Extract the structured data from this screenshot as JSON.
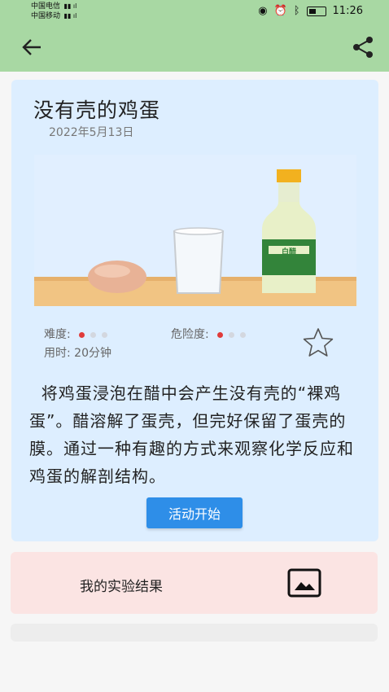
{
  "status_bar": {
    "carrier1": "中国电信",
    "carrier2": "中国移动",
    "time": "11:26"
  },
  "colors": {
    "appbar": "#a8d8a3",
    "card_bg": "#ddeeff",
    "result_bg": "#fbe4e3",
    "accent_button": "#2e8ee8",
    "level_dot": "#e03b3b"
  },
  "icons": {
    "back": "arrow-left",
    "share": "share",
    "favorite": "star-outline",
    "image": "image-frame"
  },
  "article": {
    "title": "没有壳的鸡蛋",
    "date": "2022年5月13日",
    "bottle_label": "白醋",
    "difficulty_label": "难度:",
    "difficulty_level": 1,
    "difficulty_max": 3,
    "danger_label": "危险度:",
    "danger_level": 1,
    "danger_max": 3,
    "time_label": "用时: 20分钟",
    "description": "将鸡蛋浸泡在醋中会产生没有壳的“裸鸡蛋”。醋溶解了蛋壳，但完好保留了蛋壳的膜。通过一种有趣的方式来观察化学反应和鸡蛋的解剖结构。",
    "start_button": "活动开始"
  },
  "result": {
    "label": "我的实验结果"
  }
}
